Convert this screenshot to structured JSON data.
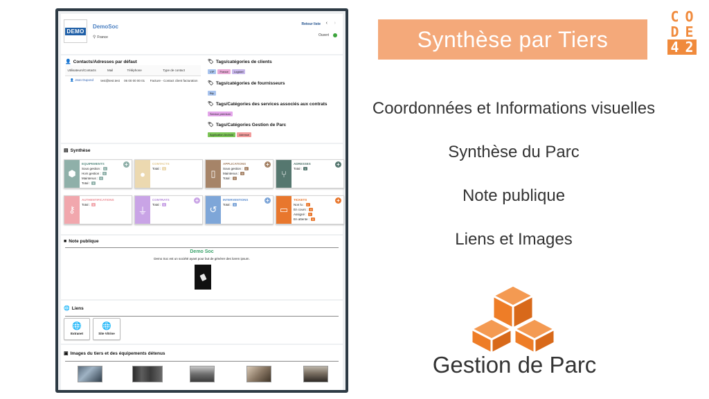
{
  "header": {
    "logo_text": "DEMO",
    "company_name": "DemoSoc",
    "country": "France",
    "back_link": "Retour liste",
    "nav_prev": "‹",
    "nav_next": "›",
    "status": "Ouvert"
  },
  "contacts": {
    "title": "Contacts/Adresses par défaut",
    "columns": [
      "Utilisateurs/Contacts",
      "Mail",
      "Téléphone",
      "Type de contact"
    ],
    "rows": [
      {
        "name": "Jean Dupond",
        "mail": "test@test.test",
        "phone": "06 00 00 00 01",
        "type": "Facture - Contact client facturation"
      }
    ]
  },
  "tags": {
    "clients_title": "Tags/catégories de clients",
    "clients": [
      "VIP",
      "France",
      "Logiciel"
    ],
    "fournisseurs_title": "Tags/catégories de fournisseurs",
    "fournisseurs": [
      "Bty"
    ],
    "services_title": "Tags/Catégories des services associés aux contrats",
    "services": [
      "Service premium"
    ],
    "parc_title": "Tags/Catégories Gestion de Parc",
    "parc": [
      "Application Android",
      "Adresse"
    ]
  },
  "synthese": {
    "title": "Synthèse",
    "cards": [
      {
        "title": "EQUIPEMENTS",
        "lines": [
          {
            "label": "Sous gestion :",
            "value": "3"
          },
          {
            "label": "Hors gestion :",
            "value": "0"
          },
          {
            "label": "Maintenus :",
            "value": "0"
          },
          {
            "label": "Total :",
            "value": "3"
          }
        ]
      },
      {
        "title": "CONTACTS",
        "lines": [
          {
            "label": "Total :",
            "value": "1"
          }
        ]
      },
      {
        "title": "APPLICATIONS",
        "lines": [
          {
            "label": "Sous gestion :",
            "value": "1"
          },
          {
            "label": "Maintenus :",
            "value": "0"
          },
          {
            "label": "Total :",
            "value": "1"
          }
        ]
      },
      {
        "title": "ADRESSES",
        "lines": [
          {
            "label": "Total :",
            "value": "1"
          }
        ]
      },
      {
        "title": "AUTHENTIFICATIONS",
        "lines": [
          {
            "label": "Total :",
            "value": "0"
          }
        ]
      },
      {
        "title": "CONTRATS",
        "lines": [
          {
            "label": "Total :",
            "value": "0"
          }
        ]
      },
      {
        "title": "INTERVENTIONS",
        "lines": [
          {
            "label": "Total :",
            "value": "0"
          }
        ]
      },
      {
        "title": "TICKETS",
        "lines": [
          {
            "label": "Non lu :",
            "value": "0"
          },
          {
            "label": "En cours :",
            "value": "0"
          },
          {
            "label": "Assigné :",
            "value": "0"
          },
          {
            "label": "En attente :",
            "value": "0"
          }
        ]
      }
    ]
  },
  "note": {
    "title": "Note publique",
    "heading": "Demo Soc",
    "text": "Demo Soc est un société ayant pour but de générer des lorem ipsum."
  },
  "liens": {
    "title": "Liens",
    "items": [
      "Extranet",
      "Site Vitrine"
    ]
  },
  "images": {
    "title": "Images du tiers et des équipements détenus"
  },
  "right": {
    "banner": "Synthèse par Tiers",
    "brand_rows": [
      [
        "C",
        "O"
      ],
      [
        "D",
        "E"
      ],
      [
        "4",
        "2"
      ]
    ],
    "features": [
      "Coordonnées et Informations visuelles",
      "Synthèse du Parc",
      "Note publique",
      "Liens et Images"
    ],
    "subtitle": "Gestion de Parc"
  },
  "colors": {
    "accent_orange": "#f08a3c",
    "banner": "#f4a97a",
    "card_equipements": "#8fb0a9",
    "card_contacts": "#ecd9b0",
    "card_applications": "#a68468",
    "card_adresses": "#55776f",
    "card_authentifications": "#f1a7ad",
    "card_contrats": "#c9a4e6",
    "card_interventions": "#7ea6d8",
    "card_tickets": "#e8772d"
  }
}
